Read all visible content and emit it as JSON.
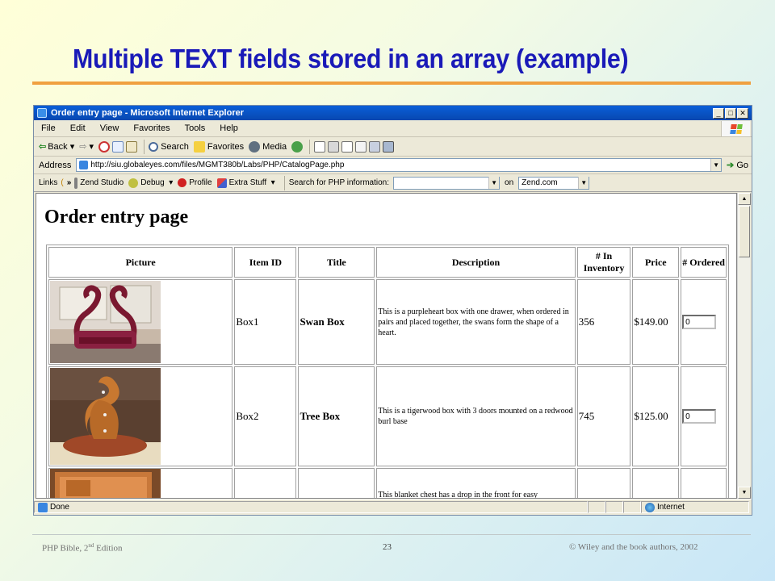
{
  "slide": {
    "title": "Multiple TEXT fields stored in an array (example)",
    "footer_left_pre": "PHP Bible, 2",
    "footer_left_sup": "nd",
    "footer_left_post": " Edition",
    "footer_page": "23",
    "footer_right": " Wiley  and the book authors, 2002"
  },
  "browser": {
    "window_title": "Order entry page - Microsoft Internet Explorer",
    "menu": [
      "File",
      "Edit",
      "View",
      "Favorites",
      "Tools",
      "Help"
    ],
    "toolbar": {
      "back": "Back",
      "search": "Search",
      "favorites": "Favorites",
      "media": "Media"
    },
    "address_label": "Address",
    "url": "http://siu.globaleyes.com/files/MGMT380b/Labs/PHP/CatalogPage.php",
    "go": "Go",
    "links_label": "Links",
    "links_bar": {
      "zend_studio": "Zend Studio",
      "debug": "Debug",
      "profile": "Profile",
      "extra_stuff": "Extra Stuff",
      "search_label": "Search for PHP information:",
      "search_value": "",
      "on_label": "on",
      "engine_value": "Zend.com"
    },
    "status": "Done",
    "zone": "Internet"
  },
  "page": {
    "heading": "Order entry page",
    "columns": [
      "Picture",
      "Item ID",
      "Title",
      "Description",
      "# In Inventory",
      "Price",
      "# Ordered"
    ],
    "rows": [
      {
        "item_id": "Box1",
        "title": "Swan Box",
        "description": "This is a purpleheart box with one drawer, when ordered in pairs and placed together, the swans form the shape of a heart.",
        "inventory": "356",
        "price": "$149.00",
        "ordered": "0"
      },
      {
        "item_id": "Box2",
        "title": "Tree Box",
        "description": "This is a tigerwood box with 3 doors mounted on a redwood burl base",
        "inventory": "745",
        "price": "$125.00",
        "ordered": "0"
      },
      {
        "item_id": "",
        "title": "",
        "description": "This blanket chest has a drop in the front for easy",
        "inventory": "",
        "price": "",
        "ordered": ""
      }
    ]
  }
}
